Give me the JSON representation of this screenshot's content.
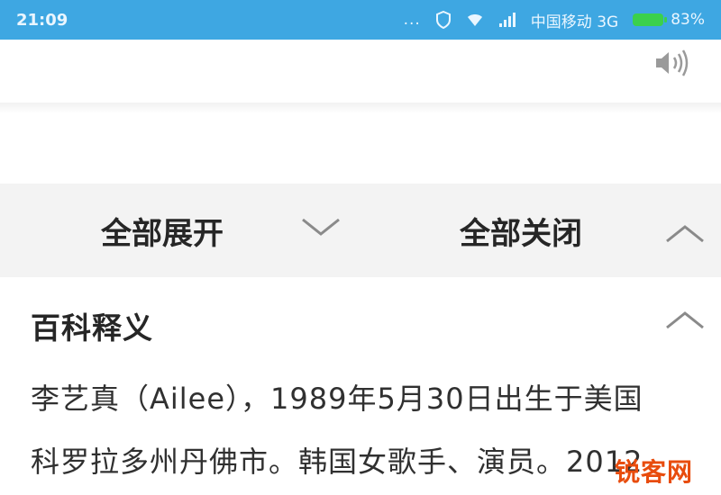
{
  "status_bar": {
    "time": "21:09",
    "dots": "...",
    "carrier": "中国移动 3G",
    "battery_pct": "83%",
    "icons": [
      "shield-icon",
      "wifi-icon",
      "signal-icon",
      "battery-icon"
    ]
  },
  "speaker": {
    "icon": "speaker-icon"
  },
  "toggle_bar": {
    "expand_all": "全部展开",
    "collapse_all": "全部关闭"
  },
  "section": {
    "title": "百科释义",
    "lines": [
      "李艺真（Ailee），1989年5月30日出生于美国",
      "科罗拉多州丹佛市。韩国女歌手、演员。2012"
    ]
  },
  "watermark": {
    "text": "锐客网"
  },
  "colors": {
    "status_bar": "#3ea7e2",
    "battery": "#3bd04c",
    "watermark": "#e84c0d"
  }
}
